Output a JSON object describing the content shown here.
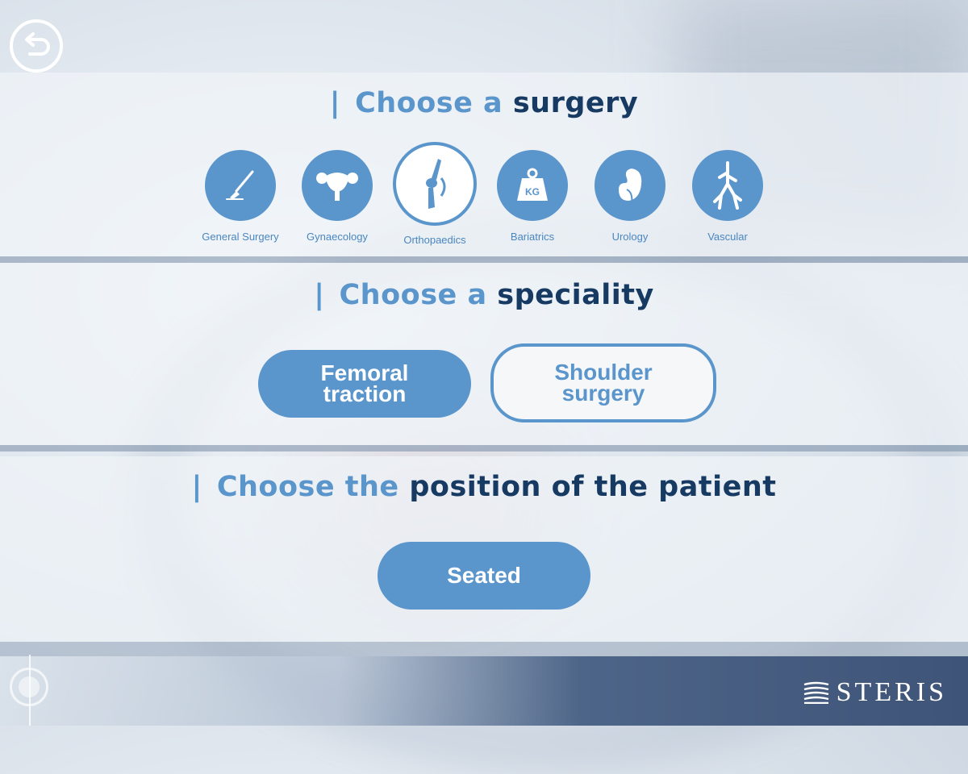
{
  "back_button": {
    "icon": "back-arrow-icon"
  },
  "surgery_section": {
    "heading_light": "Choose a",
    "heading_dark": "surgery"
  },
  "surgeries": [
    {
      "label": "General Surgery",
      "icon": "scalpel-icon",
      "selected": false
    },
    {
      "label": "Gynaecology",
      "icon": "uterus-icon",
      "selected": false
    },
    {
      "label": "Orthopaedics",
      "icon": "bone-joint-icon",
      "selected": true
    },
    {
      "label": "Bariatrics",
      "icon": "weight-kg-icon",
      "icon_text": "KG",
      "selected": false
    },
    {
      "label": "Urology",
      "icon": "kidney-icon",
      "selected": false
    },
    {
      "label": "Vascular",
      "icon": "vessels-icon",
      "selected": false
    }
  ],
  "speciality_section": {
    "heading_light": "Choose a",
    "heading_dark": "speciality"
  },
  "specialities": [
    {
      "line1": "Femoral",
      "line2": "traction",
      "selected": false
    },
    {
      "line1": "Shoulder",
      "line2": "surgery",
      "selected": true
    }
  ],
  "position_section": {
    "heading_light": "Choose the",
    "heading_dark": "position of the patient"
  },
  "positions": [
    {
      "label": "Seated"
    }
  ],
  "brand": {
    "name": "STERIS"
  },
  "colors": {
    "accent": "#5a95cc",
    "dark": "#173a63"
  }
}
